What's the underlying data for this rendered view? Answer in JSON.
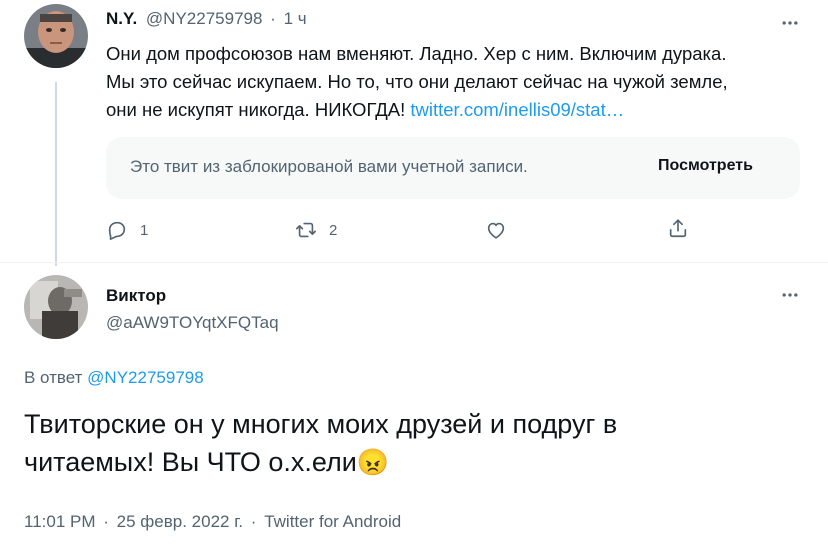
{
  "tweet1": {
    "name": "N.Y.",
    "handle": "@NY22759798",
    "sep": "·",
    "time": "1 ч",
    "line1": "Они дом профсоюзов нам вменяют. Ладно. Хер с ним. Включим дурака.",
    "line2": "Мы это сейчас искупаем. Но то, что они делают сейчас на чужой земле,",
    "line3_text": "они не искупят никогда. НИКОГДА! ",
    "line3_link": "twitter.com/inellis09/stat…",
    "quote_text": "Это твит из заблокированой вами учетной записи.",
    "quote_button": "Посмотреть",
    "replies": "1",
    "retweets": "2",
    "more_icon": "more-horizontal-icon"
  },
  "tweet2": {
    "name": "Виктор",
    "handle": "@aAW9TOYqtXFQTaq",
    "reply_prefix": "В ответ ",
    "reply_to": "@NY22759798",
    "text_line1": "Твиторские он у многих моих друзей и подруг в",
    "text_line2": "читаемых! Вы ЧТО о.х.ели",
    "emoji": "😠",
    "time": "11:01 PM",
    "dot": "·",
    "date": "25 февр. 2022 г.",
    "source": "Twitter for Android"
  },
  "colors": {
    "link": "#1d9bf0",
    "muted": "#536471",
    "text": "#0f1419",
    "border": "#cfd9de"
  }
}
